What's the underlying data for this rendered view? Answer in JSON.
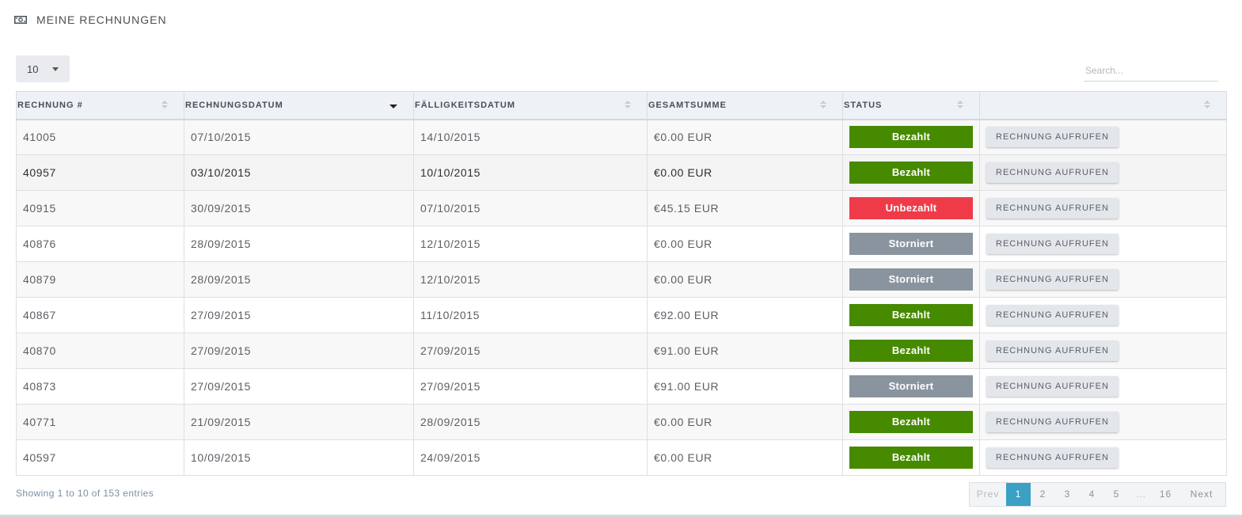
{
  "header": {
    "title": "MEINE RECHNUNGEN",
    "icon": "money-icon"
  },
  "controls": {
    "page_length": "10",
    "search_placeholder": "Search..."
  },
  "table": {
    "columns": [
      "RECHNUNG #",
      "RECHNUNGSDATUM",
      "FÄLLIGKEITSDATUM",
      "GESAMTSUMME",
      "STATUS",
      ""
    ],
    "sorted_column": "RECHNUNGSDATUM",
    "sort_direction": "descending",
    "action_label": "RECHNUNG AUFRUFEN",
    "rows": [
      {
        "id": "41005",
        "date": "07/10/2015",
        "due": "14/10/2015",
        "total": "€0.00 EUR",
        "status": "Bezahlt",
        "status_kind": "paid"
      },
      {
        "id": "40957",
        "date": "03/10/2015",
        "due": "10/10/2015",
        "total": "€0.00 EUR",
        "status": "Bezahlt",
        "status_kind": "paid"
      },
      {
        "id": "40915",
        "date": "30/09/2015",
        "due": "07/10/2015",
        "total": "€45.15 EUR",
        "status": "Unbezahlt",
        "status_kind": "unpaid"
      },
      {
        "id": "40876",
        "date": "28/09/2015",
        "due": "12/10/2015",
        "total": "€0.00 EUR",
        "status": "Storniert",
        "status_kind": "cancelled"
      },
      {
        "id": "40879",
        "date": "28/09/2015",
        "due": "12/10/2015",
        "total": "€0.00 EUR",
        "status": "Storniert",
        "status_kind": "cancelled"
      },
      {
        "id": "40867",
        "date": "27/09/2015",
        "due": "11/10/2015",
        "total": "€92.00 EUR",
        "status": "Bezahlt",
        "status_kind": "paid"
      },
      {
        "id": "40870",
        "date": "27/09/2015",
        "due": "27/09/2015",
        "total": "€91.00 EUR",
        "status": "Bezahlt",
        "status_kind": "paid"
      },
      {
        "id": "40873",
        "date": "27/09/2015",
        "due": "27/09/2015",
        "total": "€91.00 EUR",
        "status": "Storniert",
        "status_kind": "cancelled"
      },
      {
        "id": "40771",
        "date": "21/09/2015",
        "due": "28/09/2015",
        "total": "€0.00 EUR",
        "status": "Bezahlt",
        "status_kind": "paid"
      },
      {
        "id": "40597",
        "date": "10/09/2015",
        "due": "24/09/2015",
        "total": "€0.00 EUR",
        "status": "Bezahlt",
        "status_kind": "paid"
      }
    ]
  },
  "footer": {
    "info": "Showing 1 to 10 of 153 entries",
    "pagination": {
      "prev": "Prev",
      "pages": [
        "1",
        "2",
        "3",
        "4",
        "5",
        "...",
        "16"
      ],
      "active": "1",
      "next": "Next"
    }
  },
  "colors": {
    "paid": "#468a00",
    "unpaid": "#ef3b49",
    "cancelled": "#8a949f",
    "active_page": "#3aa0c4"
  }
}
